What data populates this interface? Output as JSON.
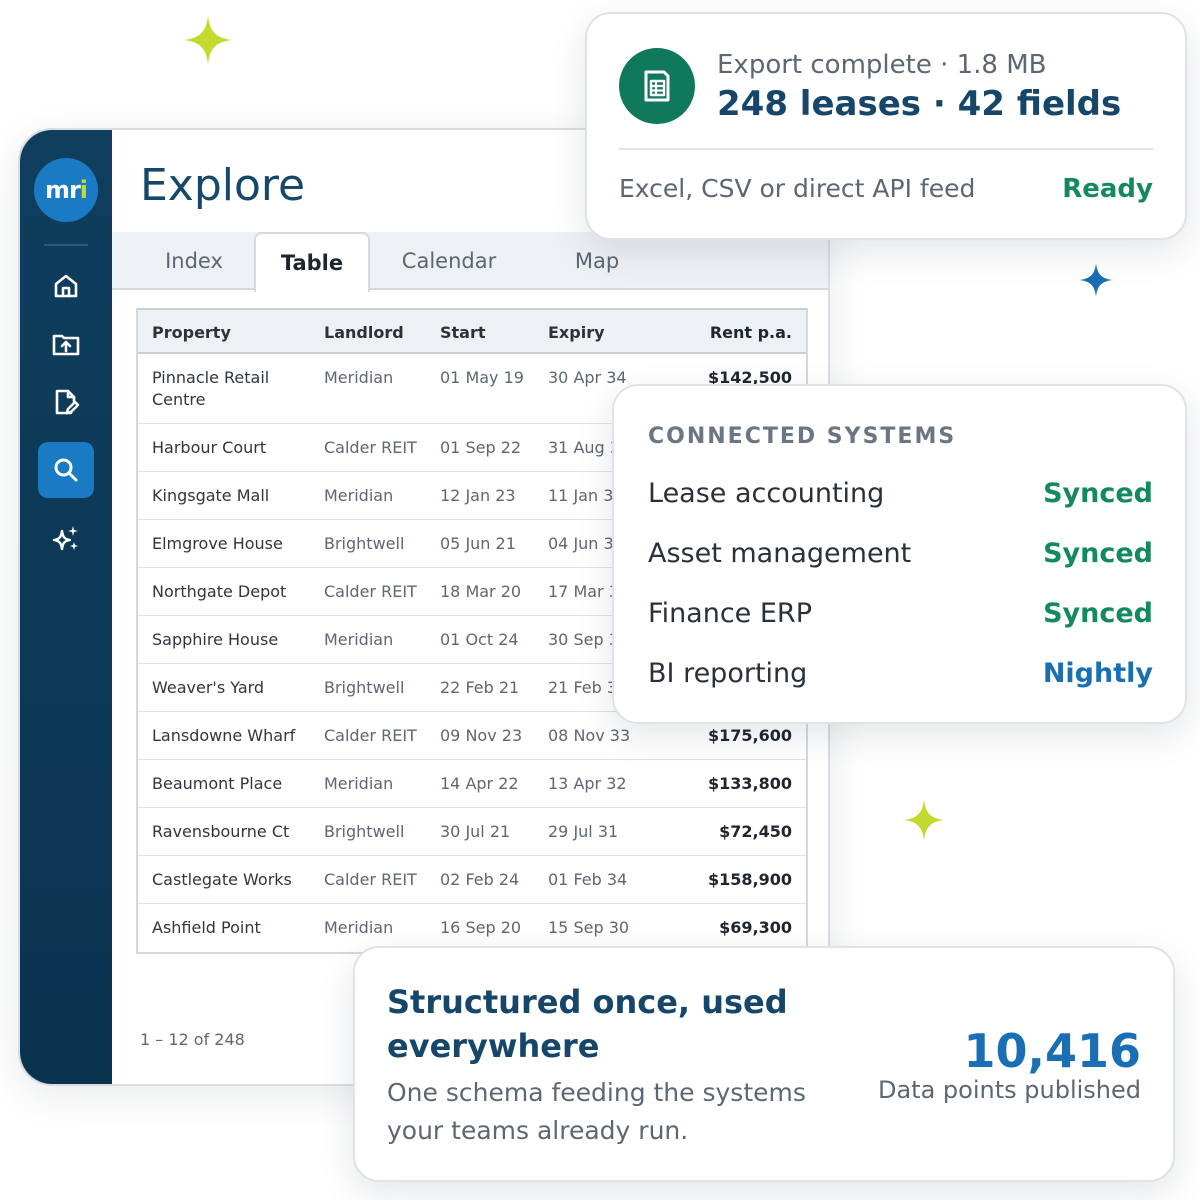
{
  "colors": {
    "sidebar": "#0f3e5e",
    "accent_blue": "#1a7ac4",
    "accent_green": "#138a5e",
    "title_navy": "#16466a",
    "sparkle_lime": "#c4d92e",
    "sparkle_blue": "#1a6fb4"
  },
  "sidebar": {
    "logo_text": "mr",
    "logo_accent": "i",
    "items": [
      {
        "icon": "home-icon"
      },
      {
        "icon": "folder-upload-icon"
      },
      {
        "icon": "document-edit-icon"
      },
      {
        "icon": "search-icon",
        "active": true
      },
      {
        "icon": "ai-sparkle-icon"
      }
    ]
  },
  "page": {
    "title": "Explore",
    "tabs": [
      {
        "label": "Index"
      },
      {
        "label": "Table",
        "active": true
      },
      {
        "label": "Calendar"
      },
      {
        "label": "Map"
      }
    ]
  },
  "table": {
    "columns": [
      "Property",
      "Landlord",
      "Start",
      "Expiry",
      "Rent p.a."
    ],
    "rows": [
      {
        "property": "Pinnacle Retail Centre",
        "landlord": "Meridian",
        "start": "01 May 19",
        "expiry": "30 Apr 34",
        "rent": "$142,500"
      },
      {
        "property": "Harbour Court",
        "landlord": "Calder REIT",
        "start": "01 Sep 22",
        "expiry": "31 Aug 32",
        "rent": ""
      },
      {
        "property": "Kingsgate Mall",
        "landlord": "Meridian",
        "start": "12 Jan 23",
        "expiry": "11 Jan 33",
        "rent": ""
      },
      {
        "property": "Elmgrove House",
        "landlord": "Brightwell",
        "start": "05 Jun 21",
        "expiry": "04 Jun 31",
        "rent": ""
      },
      {
        "property": "Northgate Depot",
        "landlord": "Calder REIT",
        "start": "18 Mar 20",
        "expiry": "17 Mar 30",
        "rent": ""
      },
      {
        "property": "Sapphire House",
        "landlord": "Meridian",
        "start": "01 Oct 24",
        "expiry": "30 Sep 34",
        "rent": ""
      },
      {
        "property": "Weaver's Yard",
        "landlord": "Brightwell",
        "start": "22 Feb 21",
        "expiry": "21 Feb 31",
        "rent": ""
      },
      {
        "property": "Lansdowne Wharf",
        "landlord": "Calder REIT",
        "start": "09 Nov 23",
        "expiry": "08 Nov 33",
        "rent": "$175,600"
      },
      {
        "property": "Beaumont Place",
        "landlord": "Meridian",
        "start": "14 Apr 22",
        "expiry": "13 Apr 32",
        "rent": "$133,800"
      },
      {
        "property": "Ravensbourne Ct",
        "landlord": "Brightwell",
        "start": "30 Jul 21",
        "expiry": "29 Jul 31",
        "rent": "$72,450"
      },
      {
        "property": "Castlegate Works",
        "landlord": "Calder REIT",
        "start": "02 Feb 24",
        "expiry": "01 Feb 34",
        "rent": "$158,900"
      },
      {
        "property": "Ashfield Point",
        "landlord": "Meridian",
        "start": "16 Sep 20",
        "expiry": "15 Sep 30",
        "rent": "$69,300"
      }
    ],
    "pagination": "1 – 12 of 248"
  },
  "export": {
    "subtitle": "Export complete · 1.8 MB",
    "headline": "248 leases · 42 fields",
    "formats": "Excel, CSV or direct API feed",
    "status": "Ready",
    "icon": "spreadsheet-icon"
  },
  "systems": {
    "title": "CONNECTED SYSTEMS",
    "items": [
      {
        "name": "Lease accounting",
        "status": "Synced",
        "color": "#138a5e"
      },
      {
        "name": "Asset management",
        "status": "Synced",
        "color": "#138a5e"
      },
      {
        "name": "Finance ERP",
        "status": "Synced",
        "color": "#138a5e"
      },
      {
        "name": "BI reporting",
        "status": "Nightly",
        "color": "#1a6fb4"
      }
    ]
  },
  "summary": {
    "title": "Structured once, used everywhere",
    "description": "One schema feeding the systems your teams already run.",
    "metric_value": "10,416",
    "metric_label": "Data points published"
  }
}
